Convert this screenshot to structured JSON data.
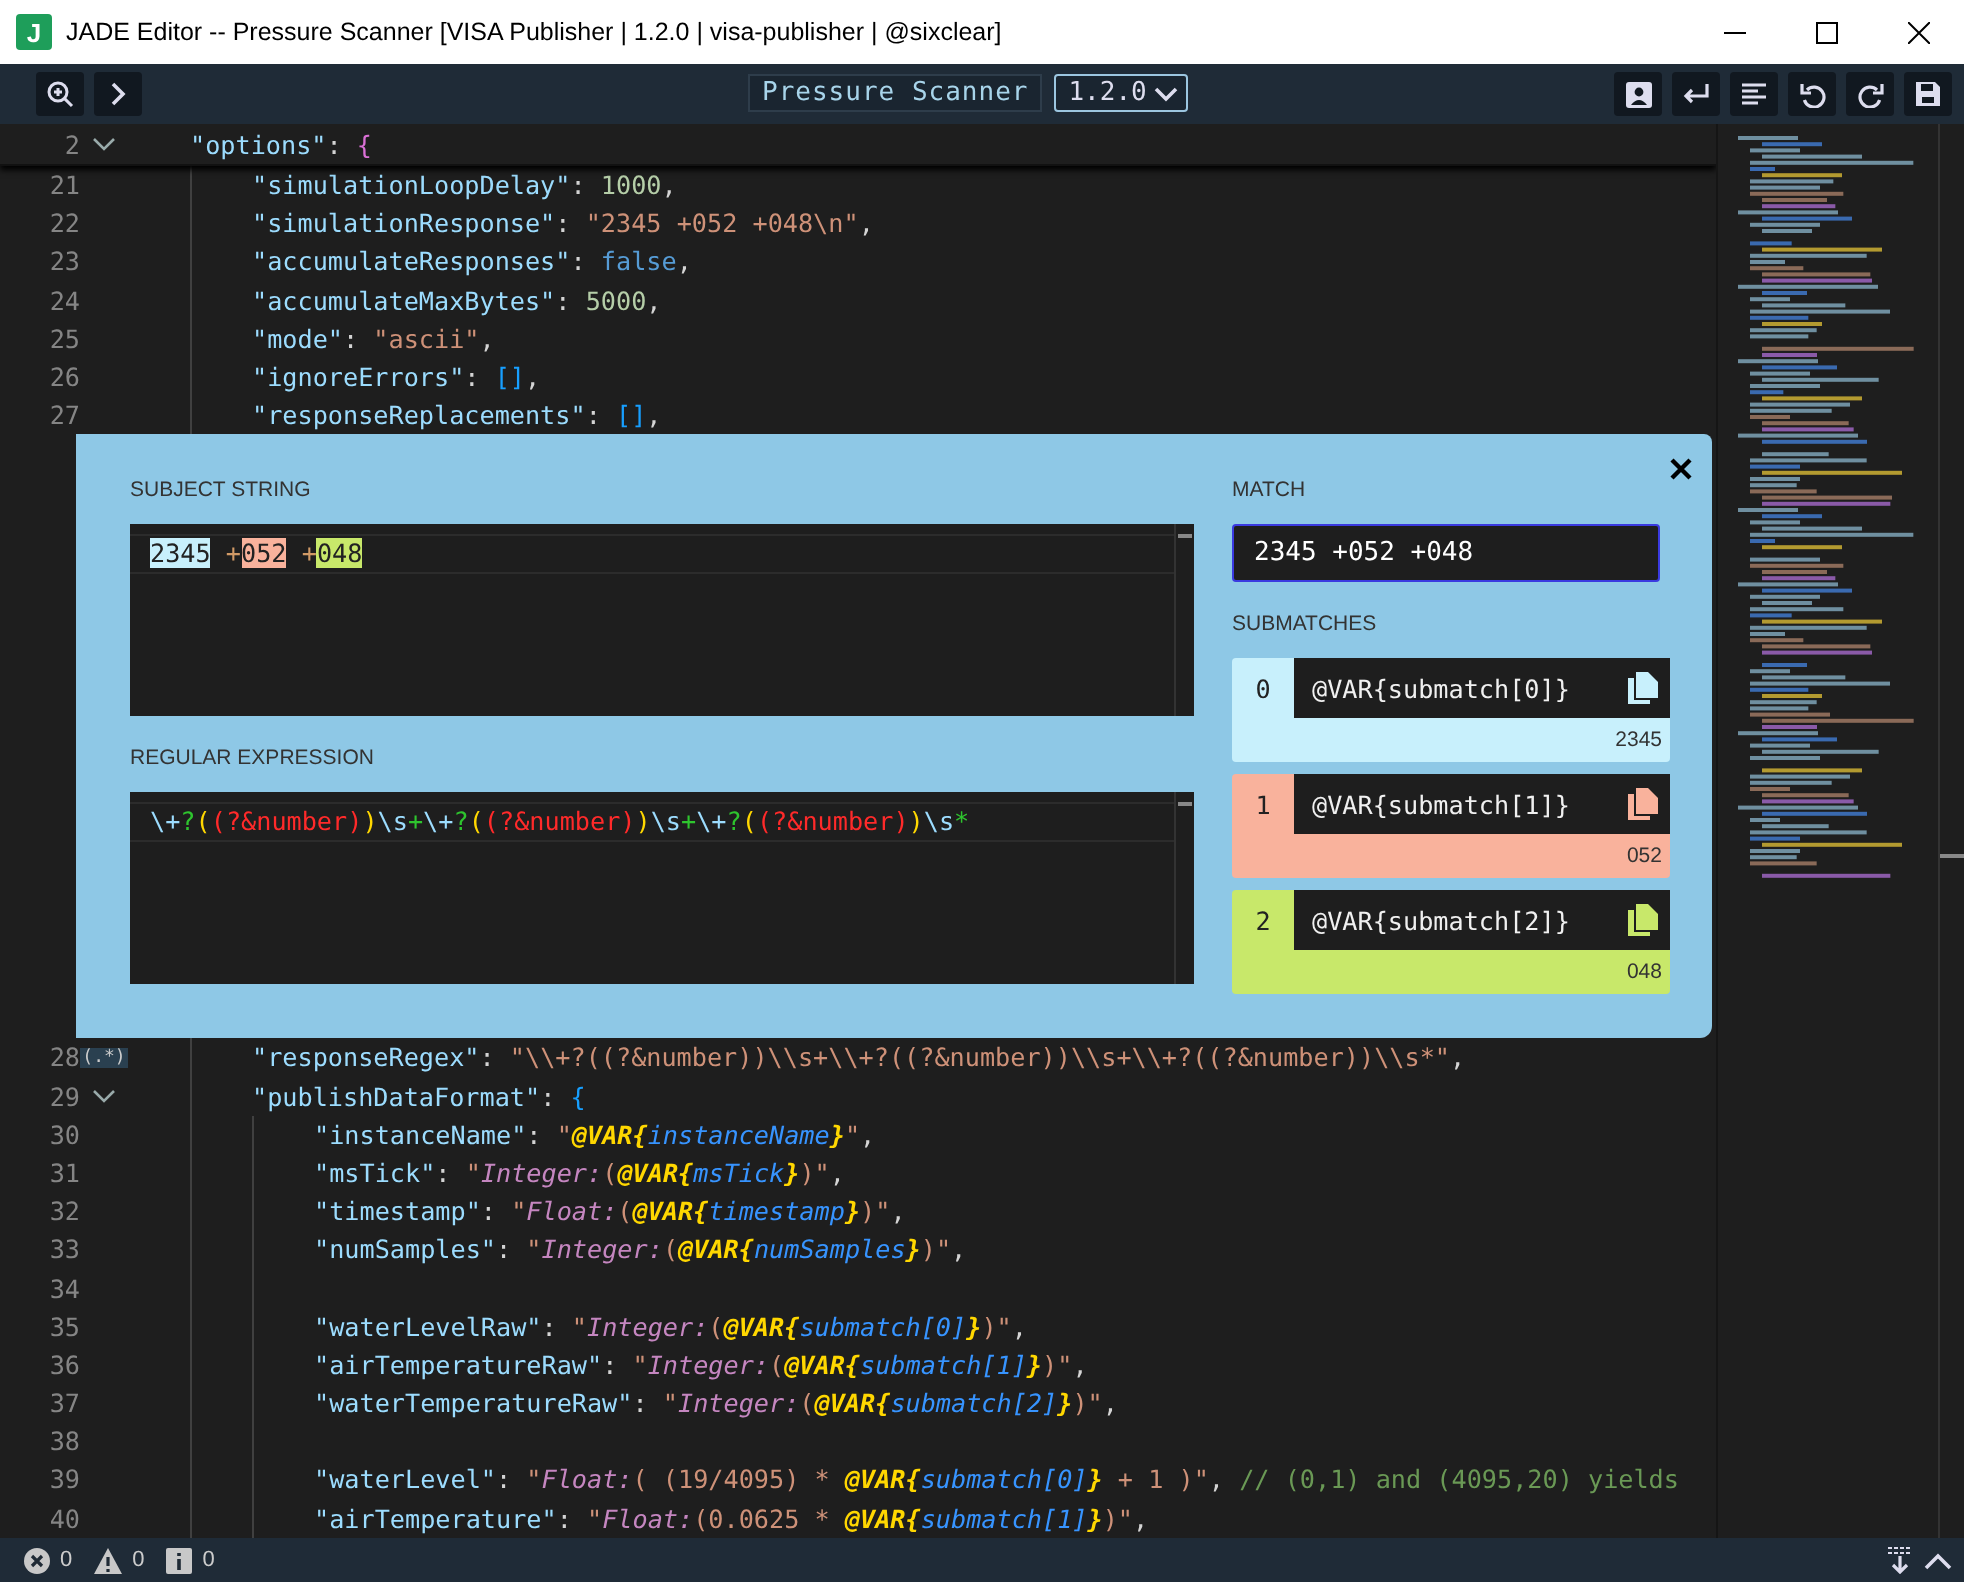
{
  "window": {
    "title": "JADE Editor -- Pressure Scanner [VISA Publisher | 1.2.0 | visa-publisher | @sixclear]",
    "logo": "J"
  },
  "toolbar": {
    "document_title": "Pressure Scanner",
    "version": "1.2.0"
  },
  "code": {
    "lines": [
      {
        "number": "2",
        "expanded": true,
        "tokens": [
          {
            "kind": "key",
            "text": "\"options\""
          },
          {
            "kind": "punct",
            "text": ": "
          },
          {
            "kind": "brace1",
            "text": "{"
          }
        ],
        "children": [
          {
            "number": "21",
            "tokens": [
              {
                "kind": "key",
                "text": "\"simulationLoopDelay\""
              },
              {
                "kind": "punct",
                "text": ": "
              },
              {
                "kind": "num",
                "text": "1000"
              },
              {
                "kind": "punct",
                "text": ","
              }
            ]
          },
          {
            "number": "22",
            "tokens": [
              {
                "kind": "key",
                "text": "\"simulationResponse\""
              },
              {
                "kind": "punct",
                "text": ": "
              },
              {
                "kind": "str",
                "text": "\"2345 +052 +048\\n\""
              },
              {
                "kind": "punct",
                "text": ","
              }
            ]
          },
          {
            "number": "23",
            "tokens": [
              {
                "kind": "key",
                "text": "\"accumulateResponses\""
              },
              {
                "kind": "punct",
                "text": ": "
              },
              {
                "kind": "kw",
                "text": "false"
              },
              {
                "kind": "punct",
                "text": ","
              }
            ]
          },
          {
            "number": "24",
            "tokens": [
              {
                "kind": "key",
                "text": "\"accumulateMaxBytes\""
              },
              {
                "kind": "punct",
                "text": ": "
              },
              {
                "kind": "num",
                "text": "5000"
              },
              {
                "kind": "punct",
                "text": ","
              }
            ]
          },
          {
            "number": "25",
            "tokens": [
              {
                "kind": "key",
                "text": "\"mode\""
              },
              {
                "kind": "punct",
                "text": ": "
              },
              {
                "kind": "str",
                "text": "\"ascii\""
              },
              {
                "kind": "punct",
                "text": ","
              }
            ]
          },
          {
            "number": "26",
            "tokens": [
              {
                "kind": "key",
                "text": "\"ignoreErrors\""
              },
              {
                "kind": "punct",
                "text": ": "
              },
              {
                "kind": "brace2",
                "text": "[]"
              },
              {
                "kind": "punct",
                "text": ","
              }
            ]
          },
          {
            "number": "27",
            "tokens": [
              {
                "kind": "key",
                "text": "\"responseReplacements\""
              },
              {
                "kind": "punct",
                "text": ": "
              },
              {
                "kind": "brace2",
                "text": "[]"
              },
              {
                "kind": "punct",
                "text": ","
              }
            ]
          },
          {
            "number": "28",
            "badge": "(.*)",
            "tokens": [
              {
                "kind": "key",
                "text": "\"responseRegex\""
              },
              {
                "kind": "punct",
                "text": ": "
              },
              {
                "kind": "str",
                "text": "\"\\\\+?((?&number))\\\\s+\\\\+?((?&number))\\\\s+\\\\+?((?&number))\\\\s*\""
              },
              {
                "kind": "punct",
                "text": ","
              }
            ]
          },
          {
            "number": "29",
            "expanded": true,
            "tokens": [
              {
                "kind": "key",
                "text": "\"publishDataFormat\""
              },
              {
                "kind": "punct",
                "text": ": "
              },
              {
                "kind": "brace2",
                "text": "{"
              }
            ],
            "children": [
              {
                "number": "30",
                "tokens": [
                  {
                    "kind": "key",
                    "text": "\"instanceName\""
                  },
                  {
                    "kind": "punct",
                    "text": ": "
                  },
                  {
                    "kind": "str",
                    "text": "\""
                  },
                  {
                    "kind": "var",
                    "text": "@VAR{"
                  },
                  {
                    "kind": "varname",
                    "text": "instanceName"
                  },
                  {
                    "kind": "var",
                    "text": "}"
                  },
                  {
                    "kind": "str",
                    "text": "\""
                  },
                  {
                    "kind": "punct",
                    "text": ","
                  }
                ]
              },
              {
                "number": "31",
                "tokens": [
                  {
                    "kind": "key",
                    "text": "\"msTick\""
                  },
                  {
                    "kind": "punct",
                    "text": ": "
                  },
                  {
                    "kind": "str",
                    "text": "\""
                  },
                  {
                    "kind": "type",
                    "text": "Integer:"
                  },
                  {
                    "kind": "str",
                    "text": "("
                  },
                  {
                    "kind": "var",
                    "text": "@VAR{"
                  },
                  {
                    "kind": "varname",
                    "text": "msTick"
                  },
                  {
                    "kind": "var",
                    "text": "}"
                  },
                  {
                    "kind": "str",
                    "text": ")\""
                  },
                  {
                    "kind": "punct",
                    "text": ","
                  }
                ]
              },
              {
                "number": "32",
                "tokens": [
                  {
                    "kind": "key",
                    "text": "\"timestamp\""
                  },
                  {
                    "kind": "punct",
                    "text": ": "
                  },
                  {
                    "kind": "str",
                    "text": "\""
                  },
                  {
                    "kind": "type",
                    "text": "Float:"
                  },
                  {
                    "kind": "str",
                    "text": "("
                  },
                  {
                    "kind": "var",
                    "text": "@VAR{"
                  },
                  {
                    "kind": "varname",
                    "text": "timestamp"
                  },
                  {
                    "kind": "var",
                    "text": "}"
                  },
                  {
                    "kind": "str",
                    "text": ")\""
                  },
                  {
                    "kind": "punct",
                    "text": ","
                  }
                ]
              },
              {
                "number": "33",
                "tokens": [
                  {
                    "kind": "key",
                    "text": "\"numSamples\""
                  },
                  {
                    "kind": "punct",
                    "text": ": "
                  },
                  {
                    "kind": "str",
                    "text": "\""
                  },
                  {
                    "kind": "type",
                    "text": "Integer:"
                  },
                  {
                    "kind": "str",
                    "text": "("
                  },
                  {
                    "kind": "var",
                    "text": "@VAR{"
                  },
                  {
                    "kind": "varname",
                    "text": "numSamples"
                  },
                  {
                    "kind": "var",
                    "text": "}"
                  },
                  {
                    "kind": "str",
                    "text": ")\""
                  },
                  {
                    "kind": "punct",
                    "text": ","
                  }
                ]
              },
              {
                "number": "34"
              },
              {
                "number": "35",
                "tokens": [
                  {
                    "kind": "key",
                    "text": "\"waterLevelRaw\""
                  },
                  {
                    "kind": "punct",
                    "text": ": "
                  },
                  {
                    "kind": "str",
                    "text": "\""
                  },
                  {
                    "kind": "type",
                    "text": "Integer:"
                  },
                  {
                    "kind": "str",
                    "text": "("
                  },
                  {
                    "kind": "var",
                    "text": "@VAR{"
                  },
                  {
                    "kind": "varname",
                    "text": "submatch[0]"
                  },
                  {
                    "kind": "var",
                    "text": "}"
                  },
                  {
                    "kind": "str",
                    "text": ")\""
                  },
                  {
                    "kind": "punct",
                    "text": ","
                  }
                ]
              },
              {
                "number": "36",
                "tokens": [
                  {
                    "kind": "key",
                    "text": "\"airTemperatureRaw\""
                  },
                  {
                    "kind": "punct",
                    "text": ": "
                  },
                  {
                    "kind": "str",
                    "text": "\""
                  },
                  {
                    "kind": "type",
                    "text": "Integer:"
                  },
                  {
                    "kind": "str",
                    "text": "("
                  },
                  {
                    "kind": "var",
                    "text": "@VAR{"
                  },
                  {
                    "kind": "varname",
                    "text": "submatch[1]"
                  },
                  {
                    "kind": "var",
                    "text": "}"
                  },
                  {
                    "kind": "str",
                    "text": ")\""
                  },
                  {
                    "kind": "punct",
                    "text": ","
                  }
                ]
              },
              {
                "number": "37",
                "tokens": [
                  {
                    "kind": "key",
                    "text": "\"waterTemperatureRaw\""
                  },
                  {
                    "kind": "punct",
                    "text": ": "
                  },
                  {
                    "kind": "str",
                    "text": "\""
                  },
                  {
                    "kind": "type",
                    "text": "Integer:"
                  },
                  {
                    "kind": "str",
                    "text": "("
                  },
                  {
                    "kind": "var",
                    "text": "@VAR{"
                  },
                  {
                    "kind": "varname",
                    "text": "submatch[2]"
                  },
                  {
                    "kind": "var",
                    "text": "}"
                  },
                  {
                    "kind": "str",
                    "text": ")\""
                  },
                  {
                    "kind": "punct",
                    "text": ","
                  }
                ]
              },
              {
                "number": "38"
              },
              {
                "number": "39",
                "tokens": [
                  {
                    "kind": "key",
                    "text": "\"waterLevel\""
                  },
                  {
                    "kind": "punct",
                    "text": ": "
                  },
                  {
                    "kind": "str",
                    "text": "\""
                  },
                  {
                    "kind": "type",
                    "text": "Float:"
                  },
                  {
                    "kind": "str",
                    "text": "( (19/4095) * "
                  },
                  {
                    "kind": "var",
                    "text": "@VAR{"
                  },
                  {
                    "kind": "varname",
                    "text": "submatch[0]"
                  },
                  {
                    "kind": "var",
                    "text": "}"
                  },
                  {
                    "kind": "str",
                    "text": " + 1 )\""
                  },
                  {
                    "kind": "punct",
                    "text": ", "
                  },
                  {
                    "kind": "comment",
                    "text": "// (0,1) and (4095,20) yields"
                  }
                ]
              },
              {
                "number": "40",
                "tokens": [
                  {
                    "kind": "key",
                    "text": "\"airTemperature\""
                  },
                  {
                    "kind": "punct",
                    "text": ": "
                  },
                  {
                    "kind": "str",
                    "text": "\""
                  },
                  {
                    "kind": "type",
                    "text": "Float:"
                  },
                  {
                    "kind": "str",
                    "text": "(0.0625 * "
                  },
                  {
                    "kind": "var",
                    "text": "@VAR{"
                  },
                  {
                    "kind": "varname",
                    "text": "submatch[1]"
                  },
                  {
                    "kind": "var",
                    "text": "}"
                  },
                  {
                    "kind": "str",
                    "text": ")\""
                  },
                  {
                    "kind": "punct",
                    "text": ","
                  }
                ]
              }
            ]
          }
        ]
      }
    ]
  },
  "regex_panel": {
    "subject_label": "SUBJECT STRING",
    "subject": [
      {
        "text": "2345",
        "color": "#c8f0fc"
      },
      {
        "text": " +"
      },
      {
        "text": "052",
        "color": "#f9b29c"
      },
      {
        "text": " +"
      },
      {
        "text": "048",
        "color": "#c8e86a"
      }
    ],
    "regex_label": "REGULAR EXPRESSION",
    "regex": [
      {
        "kind": "esc",
        "text": "\\+"
      },
      {
        "kind": "quant",
        "text": "?"
      },
      {
        "kind": "paren",
        "text": "("
      },
      {
        "kind": "group",
        "text": "(?&number)"
      },
      {
        "kind": "paren",
        "text": ")"
      },
      {
        "kind": "esc",
        "text": "\\s"
      },
      {
        "kind": "quant",
        "text": "+"
      },
      {
        "kind": "esc",
        "text": "\\+"
      },
      {
        "kind": "quant",
        "text": "?"
      },
      {
        "kind": "paren",
        "text": "("
      },
      {
        "kind": "group",
        "text": "(?&number)"
      },
      {
        "kind": "paren",
        "text": ")"
      },
      {
        "kind": "esc",
        "text": "\\s"
      },
      {
        "kind": "quant",
        "text": "+"
      },
      {
        "kind": "esc",
        "text": "\\+"
      },
      {
        "kind": "quant",
        "text": "?"
      },
      {
        "kind": "paren",
        "text": "("
      },
      {
        "kind": "group",
        "text": "(?&number)"
      },
      {
        "kind": "paren",
        "text": ")"
      },
      {
        "kind": "esc",
        "text": "\\s"
      },
      {
        "kind": "quant",
        "text": "*"
      }
    ],
    "match_label": "MATCH",
    "match": "2345 +052 +048",
    "submatches_label": "SUBMATCHES",
    "submatches": [
      {
        "index": "0",
        "expression": "@VAR{submatch[0]}",
        "value": "2345",
        "color": "#c8f0fc"
      },
      {
        "index": "1",
        "expression": "@VAR{submatch[1]}",
        "value": "052",
        "color": "#f9b29c"
      },
      {
        "index": "2",
        "expression": "@VAR{submatch[2]}",
        "value": "048",
        "color": "#c8e86a"
      }
    ]
  },
  "status_bar": {
    "errors": "0",
    "warnings": "0",
    "infos": "0"
  }
}
